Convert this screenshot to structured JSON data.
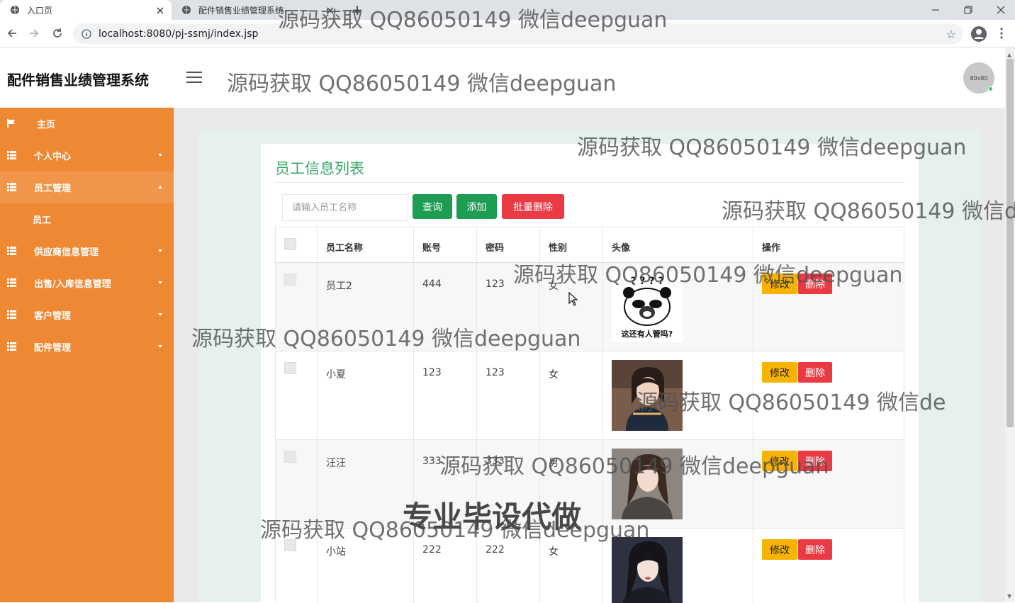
{
  "browser": {
    "tabs": [
      {
        "title": "入口页",
        "active": true
      },
      {
        "title": "配件销售业绩管理系统",
        "active": false
      }
    ],
    "url": "localhost:8080/pj-ssmj/index.jsp"
  },
  "app": {
    "title": "配件销售业绩管理系统",
    "avatar_text": "80x80"
  },
  "sidebar": {
    "items": [
      {
        "label": "主页",
        "icon": "flag-icon",
        "has_caret": false
      },
      {
        "label": "个人中心",
        "icon": "grid-icon",
        "has_caret": true
      },
      {
        "label": "员工管理",
        "icon": "grid-icon",
        "has_caret": true,
        "open": true
      },
      {
        "label": "供应商信息管理",
        "icon": "grid-icon",
        "has_caret": true
      },
      {
        "label": "出售/入库信息管理",
        "icon": "grid-icon",
        "has_caret": true
      },
      {
        "label": "客户管理",
        "icon": "grid-icon",
        "has_caret": true
      },
      {
        "label": "配件管理",
        "icon": "grid-icon",
        "has_caret": true
      }
    ],
    "sub_item": "员工"
  },
  "main": {
    "title": "员工信息列表",
    "search": {
      "placeholder": "请输入员工名称",
      "value": ""
    },
    "buttons": {
      "query": "查询",
      "add": "添加",
      "batch_delete": "批量删除"
    },
    "table": {
      "headers": [
        "员工名称",
        "账号",
        "密码",
        "性别",
        "头像",
        "操作"
      ],
      "rows": [
        {
          "name": "员工2",
          "account": "444",
          "password": "123",
          "gender": "女",
          "photo": "panda-meme",
          "photo_caption": "这还有人管吗?"
        },
        {
          "name": "小夏",
          "account": "123",
          "password": "123",
          "gender": "女",
          "photo": "portrait-1"
        },
        {
          "name": "汪汪",
          "account": "333",
          "password": "333",
          "gender": "男",
          "photo": "portrait-2"
        },
        {
          "name": "小站",
          "account": "222",
          "password": "222",
          "gender": "女",
          "photo": "portrait-3"
        }
      ],
      "row_actions": {
        "edit": "修改",
        "delete": "删除"
      }
    }
  },
  "watermarks": {
    "text": "源码获取 QQ86050149 微信deepguan",
    "text_truncated": "源码获取 QQ86050149 微信de",
    "big_text": "专业毕设代做"
  },
  "colors": {
    "sidebar": "#ee8833",
    "primary_green": "#1e9c53",
    "danger_red": "#ea3b45",
    "warning_yellow": "#f6b300",
    "title_green": "#3aa66a"
  }
}
